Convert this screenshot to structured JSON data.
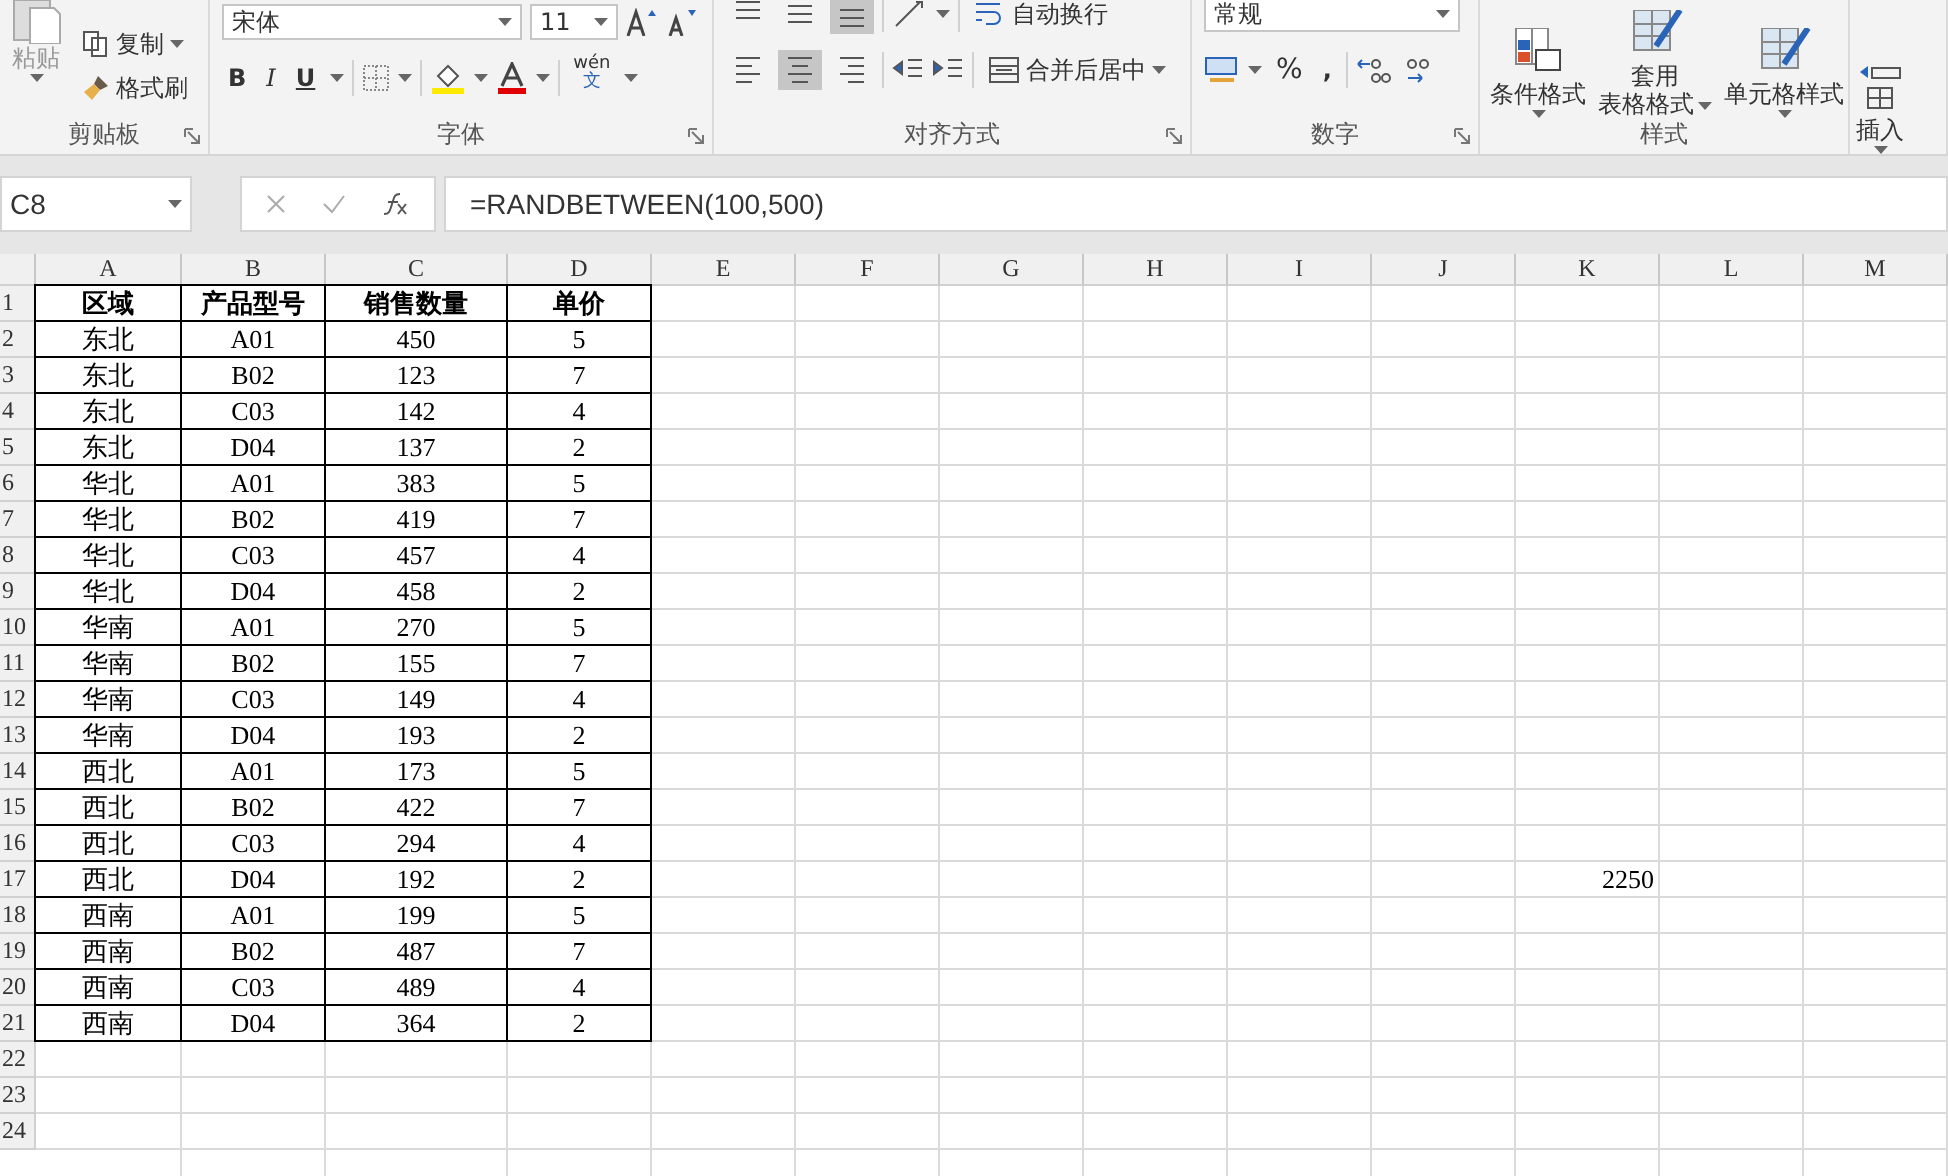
{
  "ribbon": {
    "groups": [
      {
        "kind": "clipboard",
        "label": "剪贴板",
        "paste": "粘贴",
        "copy": "复制",
        "format_painter": "格式刷"
      },
      {
        "kind": "font",
        "label": "字体",
        "font_name": "宋体",
        "font_size": "11",
        "bold": "B",
        "italic": "I",
        "underline": "U",
        "phonetic": "wén",
        "phonetic_char": "文"
      },
      {
        "kind": "alignment",
        "label": "对齐方式",
        "vertical_align": [
          {
            "selected": false
          },
          {
            "selected": false
          },
          {
            "selected": true
          }
        ],
        "horizontal_align": [
          {
            "selected": false
          },
          {
            "selected": true
          },
          {
            "selected": false
          }
        ],
        "wrap_text": "自动换行",
        "merge_center": "合并后居中"
      },
      {
        "kind": "number",
        "label": "数字",
        "format": "常规",
        "percent": "%",
        "comma": ","
      },
      {
        "kind": "styles",
        "label": "样式",
        "conditional": "条件格式",
        "table_format": [
          "套用",
          "表格格式"
        ],
        "cell_styles": "单元格样式"
      },
      {
        "kind": "cells",
        "insert": "插入"
      }
    ]
  },
  "formula_bar": {
    "name_box": "C8",
    "formula": "=RANDBETWEEN(100,500)"
  },
  "sheet": {
    "columns": [
      "A",
      "B",
      "C",
      "D",
      "E",
      "F",
      "G",
      "H",
      "I",
      "J",
      "K",
      "L",
      "M"
    ],
    "rows": [
      {
        "header": "1",
        "cells": [
          "区域",
          "产品型号",
          "销售数量",
          "单价"
        ]
      },
      {
        "header": "2",
        "cells": [
          "东北",
          "A01",
          "450",
          "5"
        ]
      },
      {
        "header": "3",
        "cells": [
          "东北",
          "B02",
          "123",
          "7"
        ]
      },
      {
        "header": "4",
        "cells": [
          "东北",
          "C03",
          "142",
          "4"
        ]
      },
      {
        "header": "5",
        "cells": [
          "东北",
          "D04",
          "137",
          "2"
        ]
      },
      {
        "header": "6",
        "cells": [
          "华北",
          "A01",
          "383",
          "5"
        ]
      },
      {
        "header": "7",
        "cells": [
          "华北",
          "B02",
          "419",
          "7"
        ]
      },
      {
        "header": "8",
        "cells": [
          "华北",
          "C03",
          "457",
          "4"
        ]
      },
      {
        "header": "9",
        "cells": [
          "华北",
          "D04",
          "458",
          "2"
        ]
      },
      {
        "header": "10",
        "cells": [
          "华南",
          "A01",
          "270",
          "5"
        ]
      },
      {
        "header": "11",
        "cells": [
          "华南",
          "B02",
          "155",
          "7"
        ]
      },
      {
        "header": "12",
        "cells": [
          "华南",
          "C03",
          "149",
          "4"
        ]
      },
      {
        "header": "13",
        "cells": [
          "华南",
          "D04",
          "193",
          "2"
        ]
      },
      {
        "header": "14",
        "cells": [
          "西北",
          "A01",
          "173",
          "5"
        ]
      },
      {
        "header": "15",
        "cells": [
          "西北",
          "B02",
          "422",
          "7"
        ]
      },
      {
        "header": "16",
        "cells": [
          "西北",
          "C03",
          "294",
          "4"
        ]
      },
      {
        "header": "17",
        "cells": [
          "西北",
          "D04",
          "192",
          "2"
        ],
        "cell_k": "2250"
      },
      {
        "header": "18",
        "cells": [
          "西南",
          "A01",
          "199",
          "5"
        ]
      },
      {
        "header": "19",
        "cells": [
          "西南",
          "B02",
          "487",
          "7"
        ]
      },
      {
        "header": "20",
        "cells": [
          "西南",
          "C03",
          "489",
          "4"
        ]
      },
      {
        "header": "21",
        "cells": [
          "西南",
          "D04",
          "364",
          "2"
        ]
      },
      {
        "header": "22"
      },
      {
        "header": "23"
      },
      {
        "header": "24"
      }
    ]
  }
}
